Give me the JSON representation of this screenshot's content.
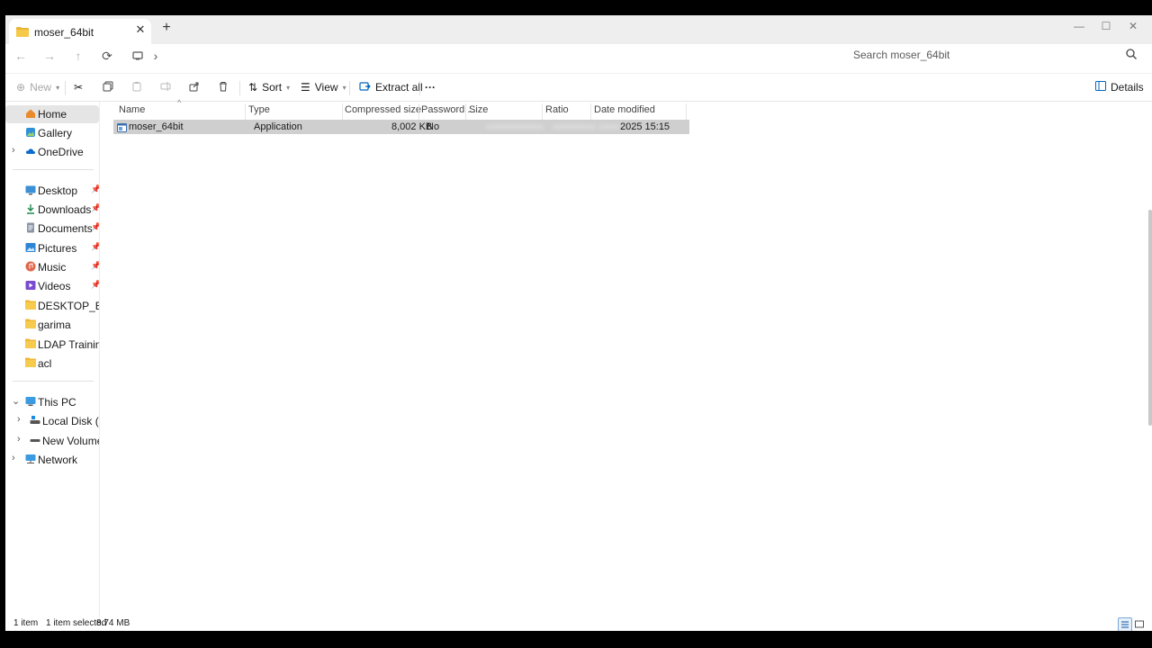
{
  "window": {
    "tab_title": "moser_64bit",
    "tab_close": "✕",
    "new_tab": "+",
    "controls": {
      "minimize": "—",
      "maximize": "☐",
      "close": "✕"
    }
  },
  "address": {
    "chevron": "›",
    "search_placeholder": "Search moser_64bit"
  },
  "toolbar": {
    "new_label": "New",
    "sort_label": "Sort",
    "view_label": "View",
    "extract_label": "Extract all",
    "more_label": "···",
    "details_label": "Details"
  },
  "sidebar": {
    "quick": [
      {
        "label": "Home"
      },
      {
        "label": "Gallery"
      },
      {
        "label": "OneDrive"
      }
    ],
    "pinned": [
      {
        "label": "Desktop"
      },
      {
        "label": "Downloads"
      },
      {
        "label": "Documents"
      },
      {
        "label": "Pictures"
      },
      {
        "label": "Music"
      },
      {
        "label": "Videos"
      },
      {
        "label": "DESKTOP_BACKUP"
      },
      {
        "label": "garima"
      },
      {
        "label": "LDAP Training"
      },
      {
        "label": "acl"
      }
    ],
    "devices": [
      {
        "label": "This PC"
      },
      {
        "label": "Local Disk (C:)"
      },
      {
        "label": "New Volume (D:)"
      },
      {
        "label": "Network"
      }
    ]
  },
  "table": {
    "columns": [
      "Name",
      "Type",
      "Compressed size",
      "Password ...",
      "Size",
      "Ratio",
      "Date modified"
    ],
    "rows": [
      {
        "name": "moser_64bit",
        "type": "Application",
        "compressed_size": "8,002 KB",
        "password": "No",
        "date_modified": "2025 15:15"
      }
    ]
  },
  "status": {
    "count": "1 item",
    "selected": "1 item selected",
    "size": "8.74 MB"
  },
  "colors": {
    "accent": "#0067c0",
    "selection": "#cfcfcf",
    "nav_selected": "#e5e5e5"
  }
}
